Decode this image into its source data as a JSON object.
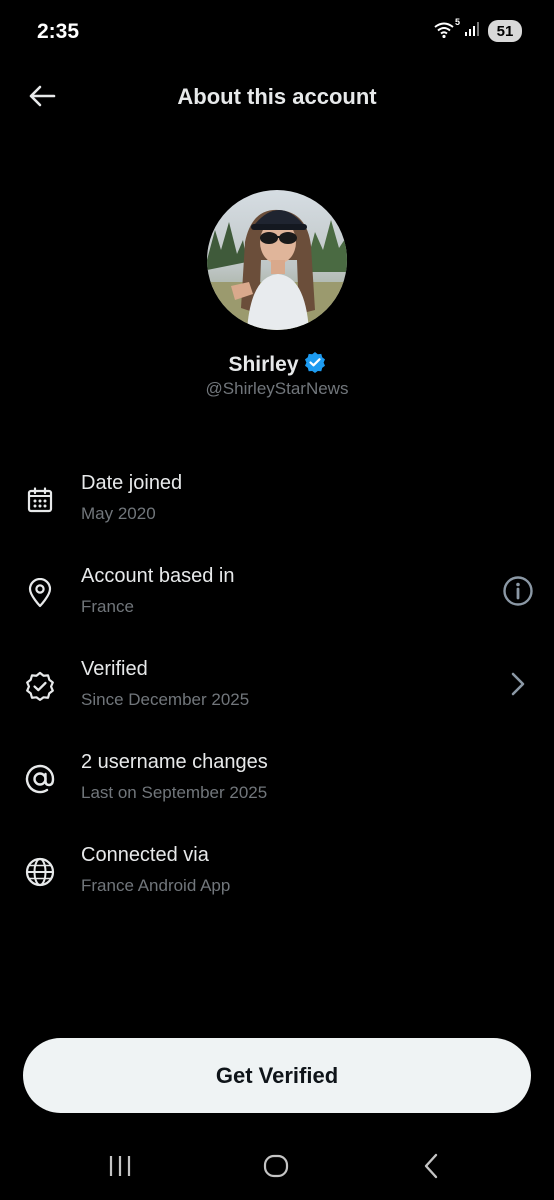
{
  "status_bar": {
    "time": "2:35",
    "wifi_badge": "5",
    "battery": "51",
    "icons": [
      "wifi-icon",
      "signal-icon",
      "battery-icon"
    ]
  },
  "header": {
    "title": "About this account",
    "back_icon": "arrow-left-icon"
  },
  "profile": {
    "name": "Shirley",
    "handle": "@ShirleyStarNews",
    "verified_badge_color": "#1d9bf0"
  },
  "rows": [
    {
      "icon": "calendar-icon",
      "label": "Date joined",
      "sub": "May 2020",
      "action": null
    },
    {
      "icon": "location-pin-icon",
      "label": "Account based in",
      "sub": "France",
      "action": "info-icon"
    },
    {
      "icon": "verified-badge-icon",
      "label": "Verified",
      "sub": "Since December 2025",
      "action": "chevron-right-icon"
    },
    {
      "icon": "at-sign-icon",
      "label": "2 username changes",
      "sub": "Last on September 2025",
      "action": null
    },
    {
      "icon": "globe-icon",
      "label": "Connected via",
      "sub": "France Android App",
      "action": null
    }
  ],
  "cta": {
    "label": "Get Verified"
  },
  "nav": {
    "icons": [
      "recent-apps-icon",
      "home-icon",
      "back-icon"
    ]
  },
  "colors": {
    "background": "#000000",
    "primary_text": "#e7e9ea",
    "secondary_text": "#71767b",
    "button_bg": "#eff3f4",
    "button_text": "#0f1419",
    "accent": "#1d9bf0"
  }
}
